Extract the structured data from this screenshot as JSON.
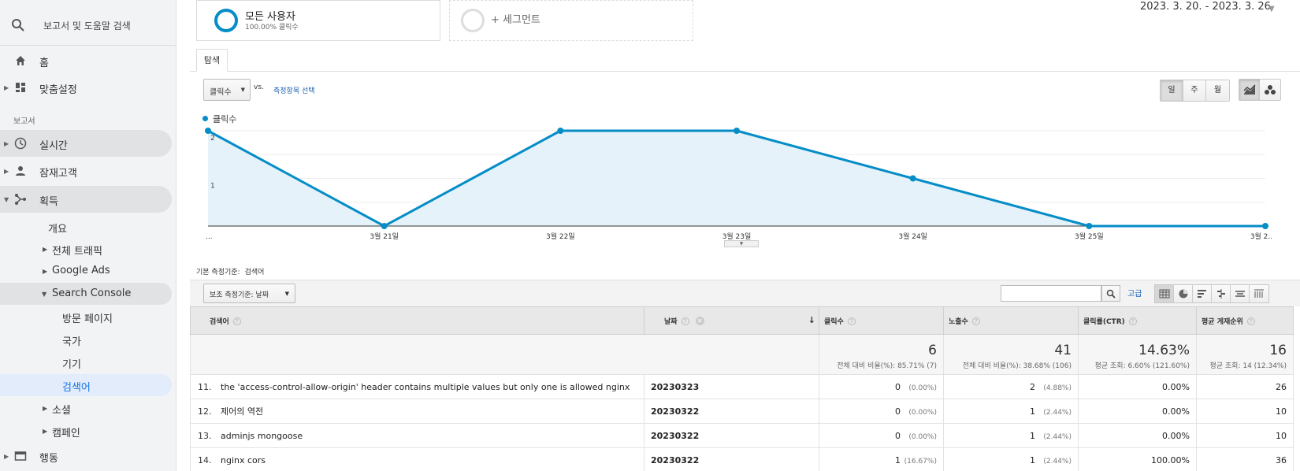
{
  "sidebar": {
    "search_placeholder": "보고서 및 도움말 검색",
    "home": "홈",
    "customization": "맞춤설정",
    "reports_section": "보고서",
    "realtime": "실시간",
    "audience": "잠재고객",
    "acquisition": "획득",
    "acquisition_items": {
      "overview": "개요",
      "all_traffic": "전체 트래픽",
      "google_ads": "Google Ads",
      "search_console": "Search Console",
      "landing_pages": "방문 페이지",
      "countries": "국가",
      "devices": "기기",
      "queries": "검색어",
      "social": "소셜",
      "campaigns": "캠페인"
    },
    "behavior": "행동"
  },
  "segments": {
    "all_users_title": "모든 사용자",
    "all_users_sub": "100.00% 클릭수",
    "add_segment": "+ 세그먼트"
  },
  "date_range": "2023. 3. 20. - 2023. 3. 26.",
  "tabs": {
    "explore": "탐색"
  },
  "metric_selector": {
    "primary": "클릭수",
    "vs": "vs.",
    "select_metric": "측정항목 선택"
  },
  "granularity": {
    "day": "일",
    "week": "주",
    "month": "월"
  },
  "colors": {
    "series": "#058dc7",
    "fill": "#e5f2f9",
    "link": "#1a5fae"
  },
  "chart_data": {
    "type": "area",
    "categories": [
      "...",
      "3월 21일",
      "3월 22일",
      "3월 23일",
      "3월 24일",
      "3월 25일",
      "3월 2..."
    ],
    "series": [
      {
        "name": "클릭수",
        "values": [
          2,
          0,
          2,
          2,
          1,
          0,
          0
        ]
      }
    ],
    "ylim": [
      0,
      2
    ],
    "yticks": [
      "2",
      "1"
    ],
    "grid": true
  },
  "table": {
    "primary_dim_label": "기본 측정기준:",
    "primary_dim_value": "검색어",
    "secondary_dim": "보조 측정기준: 날짜",
    "advanced": "고급",
    "headers": {
      "query": "검색어",
      "date": "날짜",
      "clicks": "클릭수",
      "impressions": "노출수",
      "ctr": "클릭률(CTR)",
      "position": "평균 게재순위"
    },
    "totals": {
      "clicks": "6",
      "clicks_sub": "전체 대비 비율(%): 85.71% (7)",
      "impressions": "41",
      "impressions_sub": "전체 대비 비율(%): 38.68% (106)",
      "ctr": "14.63%",
      "ctr_sub": "평균 조회: 6.60% (121.60%)",
      "position": "16",
      "position_sub": "평균 조회: 14 (12.34%)"
    },
    "rows": [
      {
        "num": "11.",
        "query": "the 'access-control-allow-origin' header contains multiple values but only one is allowed nginx",
        "date": "20230323",
        "clicks": "0",
        "clicks_pct": "(0.00%)",
        "impr": "2",
        "impr_pct": "(4.88%)",
        "ctr": "0.00%",
        "pos": "26"
      },
      {
        "num": "12.",
        "query": "제어의 역전",
        "date": "20230322",
        "clicks": "0",
        "clicks_pct": "(0.00%)",
        "impr": "1",
        "impr_pct": "(2.44%)",
        "ctr": "0.00%",
        "pos": "10"
      },
      {
        "num": "13.",
        "query": "adminjs mongoose",
        "date": "20230322",
        "clicks": "0",
        "clicks_pct": "(0.00%)",
        "impr": "1",
        "impr_pct": "(2.44%)",
        "ctr": "0.00%",
        "pos": "10"
      },
      {
        "num": "14.",
        "query": "nginx cors",
        "date": "20230322",
        "clicks": "1",
        "clicks_pct": "(16.67%)",
        "impr": "1",
        "impr_pct": "(2.44%)",
        "ctr": "100.00%",
        "pos": "36"
      }
    ]
  }
}
